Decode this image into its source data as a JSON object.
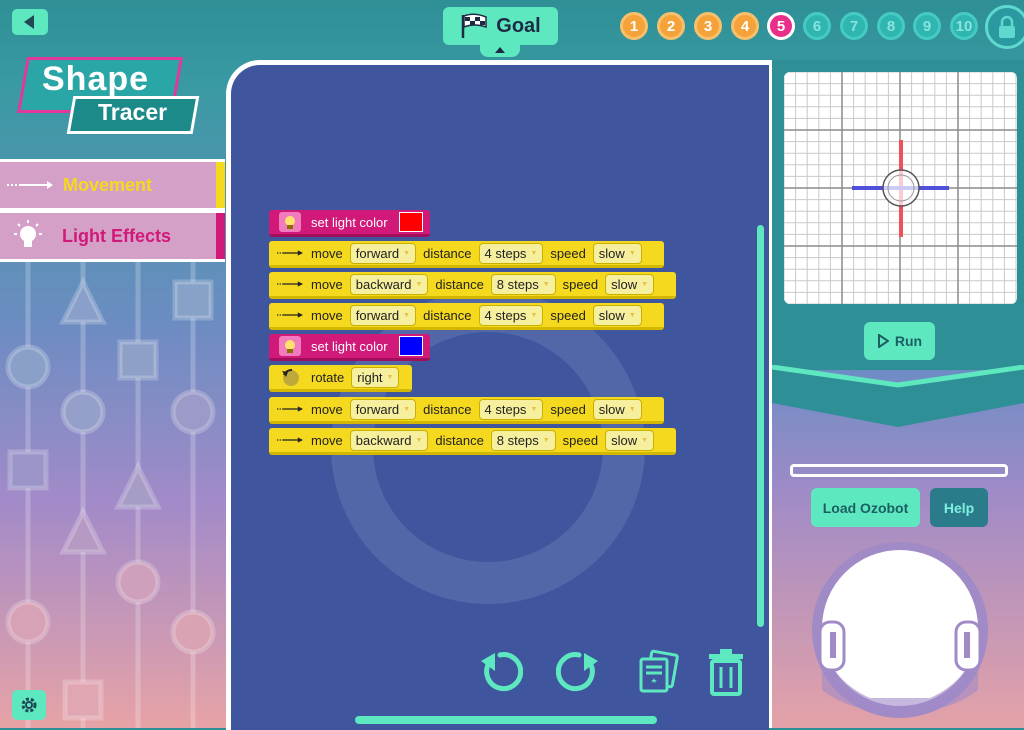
{
  "header": {
    "goal_label": "Goal",
    "levels": [
      {
        "label": "1",
        "state": "done"
      },
      {
        "label": "2",
        "state": "done"
      },
      {
        "label": "3",
        "state": "done"
      },
      {
        "label": "4",
        "state": "done"
      },
      {
        "label": "5",
        "state": "current"
      },
      {
        "label": "6",
        "state": "locked"
      },
      {
        "label": "7",
        "state": "locked"
      },
      {
        "label": "8",
        "state": "locked"
      },
      {
        "label": "9",
        "state": "locked"
      },
      {
        "label": "10",
        "state": "locked"
      }
    ]
  },
  "logo": {
    "line1": "Shape",
    "line2": "Tracer"
  },
  "categories": [
    {
      "label": "Movement",
      "color": "#f5d91e"
    },
    {
      "label": "Light Effects",
      "color": "#d1197a"
    }
  ],
  "blocks": [
    {
      "type": "light",
      "label": "set light color",
      "color": "#ff0000"
    },
    {
      "type": "move",
      "move": "move",
      "direction": "forward",
      "distance_label": "distance",
      "distance": "4 steps",
      "speed_label": "speed",
      "speed": "slow"
    },
    {
      "type": "move",
      "move": "move",
      "direction": "backward",
      "distance_label": "distance",
      "distance": "8 steps",
      "speed_label": "speed",
      "speed": "slow"
    },
    {
      "type": "move",
      "move": "move",
      "direction": "forward",
      "distance_label": "distance",
      "distance": "4 steps",
      "speed_label": "speed",
      "speed": "slow"
    },
    {
      "type": "light",
      "label": "set light color",
      "color": "#0000ff"
    },
    {
      "type": "rotate",
      "label": "rotate",
      "direction": "right"
    },
    {
      "type": "move",
      "move": "move",
      "direction": "forward",
      "distance_label": "distance",
      "distance": "4 steps",
      "speed_label": "speed",
      "speed": "slow"
    },
    {
      "type": "move",
      "move": "move",
      "direction": "backward",
      "distance_label": "distance",
      "distance": "8 steps",
      "speed_label": "speed",
      "speed": "slow"
    }
  ],
  "right_panel": {
    "run_label": "Run",
    "load_label": "Load Ozobot",
    "help_label": "Help"
  },
  "colors": {
    "accent": "#5ee8c0",
    "workspace": "#3f569f",
    "current_level": "#ea2f8a",
    "done_level": "#f5a23a"
  },
  "icons": [
    "back-arrow-icon",
    "checkered-flag-icon",
    "lock-icon",
    "lightbulb-icon",
    "arrow-icon",
    "rotate-icon",
    "undo-icon",
    "redo-icon",
    "cards-icon",
    "trash-icon",
    "play-icon",
    "gear-icon"
  ]
}
